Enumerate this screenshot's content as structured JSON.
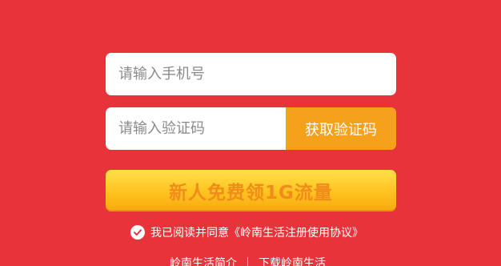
{
  "form": {
    "phone_placeholder": "请输入手机号",
    "code_placeholder": "请输入验证码",
    "get_code_label": "获取验证码",
    "claim_label": "新人免费领1G流量"
  },
  "agreement": {
    "checked": true,
    "prefix": "我已阅读并同意",
    "link_text": "《岭南生活注册使用协议》"
  },
  "footer": {
    "links": [
      "岭南生活简介",
      "下载岭南生活"
    ]
  },
  "colors": {
    "background": "#e8333a",
    "code_button": "#f5a11c",
    "claim_text": "#f08c1a"
  },
  "icons": {
    "agree_check": "check-circle-icon"
  }
}
